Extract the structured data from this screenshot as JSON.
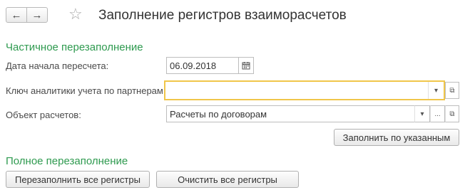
{
  "window": {
    "title": "Заполнение регистров взаиморасчетов"
  },
  "nav": {
    "back_icon": "←",
    "forward_icon": "→",
    "favorite_icon": "☆"
  },
  "partial": {
    "heading": "Частичное перезаполнение",
    "start_date_label": "Дата начала пересчета:",
    "start_date_value": "06.09.2018",
    "partner_key_label": "Ключ аналитики учета по партнерам:",
    "partner_key_value": "",
    "settlement_object_label": "Объект расчетов:",
    "settlement_object_value": "Расчеты по договорам",
    "fill_button": "Заполнить по указанным"
  },
  "full": {
    "heading": "Полное перезаполнение",
    "refill_all_button": "Перезаполнить все регистры",
    "clear_all_button": "Очистить все регистры"
  },
  "icons": {
    "dropdown": "▾",
    "open": "⧉",
    "select": "...",
    "calendar": "calendar-icon"
  }
}
